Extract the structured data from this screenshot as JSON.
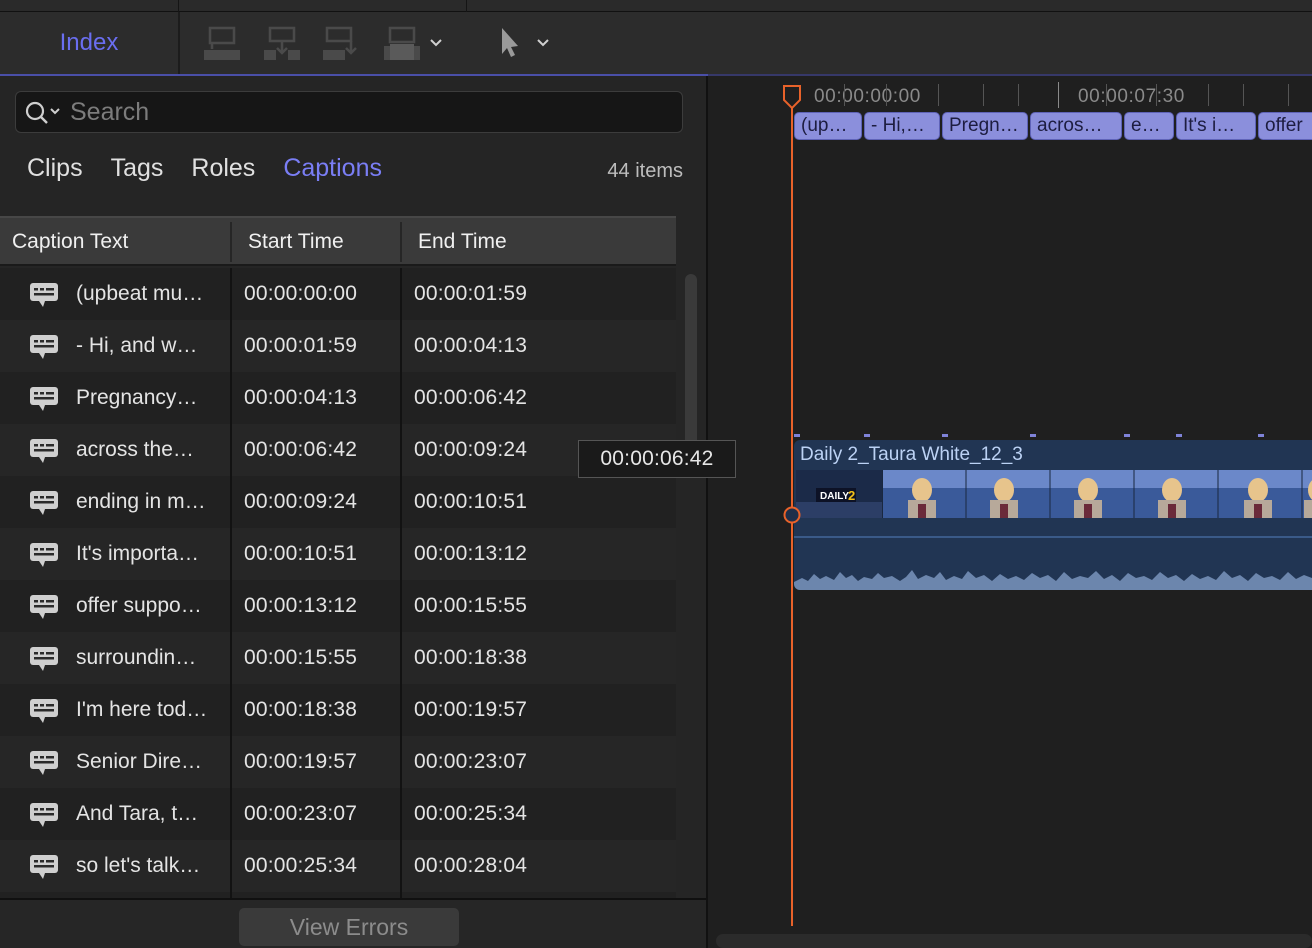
{
  "toolbar": {
    "index_label": "Index",
    "icons": [
      "connect-clip-icon",
      "insert-clip-icon",
      "append-clip-icon",
      "overwrite-clip-icon",
      "select-tool-icon"
    ]
  },
  "search": {
    "placeholder": "Search",
    "value": ""
  },
  "tabs": [
    {
      "label": "Clips",
      "active": false
    },
    {
      "label": "Tags",
      "active": false
    },
    {
      "label": "Roles",
      "active": false
    },
    {
      "label": "Captions",
      "active": true
    }
  ],
  "item_count": "44 items",
  "table": {
    "columns": [
      "Caption Text",
      "Start Time",
      "End Time"
    ],
    "rows": [
      {
        "text": "(upbeat mu…",
        "start": "00:00:00:00",
        "end": "00:00:01:59"
      },
      {
        "text": "- Hi, and w…",
        "start": "00:00:01:59",
        "end": "00:00:04:13"
      },
      {
        "text": "Pregnancy…",
        "start": "00:00:04:13",
        "end": "00:00:06:42"
      },
      {
        "text": "across the…",
        "start": "00:00:06:42",
        "end": "00:00:09:24"
      },
      {
        "text": "ending in m…",
        "start": "00:00:09:24",
        "end": "00:00:10:51"
      },
      {
        "text": "It's importa…",
        "start": "00:00:10:51",
        "end": "00:00:13:12"
      },
      {
        "text": "offer suppo…",
        "start": "00:00:13:12",
        "end": "00:00:15:55"
      },
      {
        "text": "surroundin…",
        "start": "00:00:15:55",
        "end": "00:00:18:38"
      },
      {
        "text": "I'm here tod…",
        "start": "00:00:18:38",
        "end": "00:00:19:57"
      },
      {
        "text": "Senior Dire…",
        "start": "00:00:19:57",
        "end": "00:00:23:07"
      },
      {
        "text": "And Tara, t…",
        "start": "00:00:23:07",
        "end": "00:00:25:34"
      },
      {
        "text": "so let's talk…",
        "start": "00:00:25:34",
        "end": "00:00:28:04"
      }
    ]
  },
  "tooltip": "00:00:06:42",
  "view_errors_label": "View Errors",
  "timeline": {
    "ruler_labels": [
      "00:00:00:00",
      "00:00:07:30"
    ],
    "caption_clips": [
      "(up…",
      "- Hi,…",
      "Pregn…",
      "acros…",
      "e…",
      "It's i…",
      "offer"
    ],
    "video_clip_title": "Daily 2_Taura White_12_3"
  },
  "colors": {
    "accent": "#7a7ef5",
    "caption_clip": "#8b8fdc",
    "playhead": "#e8622a",
    "video_clip": "#213553"
  }
}
